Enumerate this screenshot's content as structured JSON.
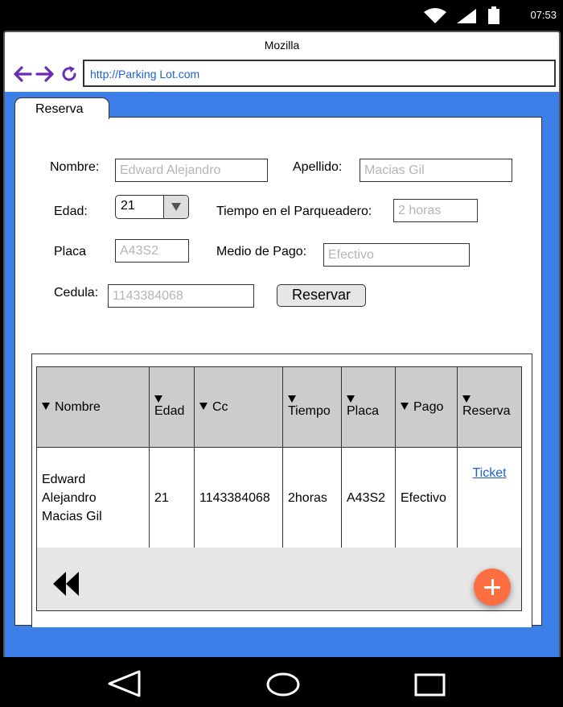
{
  "status_bar": {
    "time": "07:53"
  },
  "browser": {
    "title": "Mozilla",
    "url": "http://Parking Lot.com",
    "icons": {
      "back": "arrow-left-icon",
      "forward": "arrow-right-icon",
      "reload": "reload-icon"
    }
  },
  "tab": {
    "label": "Reserva"
  },
  "form": {
    "nombre": {
      "label": "Nombre:",
      "placeholder": "Edward Alejandro"
    },
    "apellido": {
      "label": "Apellido:",
      "placeholder": "Macias Gil"
    },
    "edad": {
      "label": "Edad:",
      "value": "21"
    },
    "tiempo": {
      "label": "Tiempo en el Parqueadero:",
      "placeholder": "2 horas"
    },
    "placa": {
      "label": "Placa",
      "placeholder": "A43S2"
    },
    "medio_pago": {
      "label": "Medio de Pago:",
      "placeholder": "Efectivo"
    },
    "cedula": {
      "label": "Cedula:",
      "placeholder": "1143384068"
    },
    "reservar_label": "Reservar"
  },
  "table": {
    "headers": [
      "Nombre",
      "Edad",
      "Cc",
      "Tiempo",
      "Placa",
      "Pago",
      "Reserva"
    ],
    "rows": [
      {
        "nombre": [
          "Edward",
          "Alejandro",
          "Macias Gil"
        ],
        "edad": "21",
        "cc": "1143384068",
        "tiempo": "2horas",
        "placa": "A43S2",
        "pago": "Efectivo",
        "reserva": "Ticket"
      }
    ]
  },
  "colors": {
    "content_bg": "#3d7fe8",
    "nav_icon": "#6a2bb5",
    "link": "#1f5fd6",
    "fab": "#ff6e40",
    "header_bg": "#cccccc"
  }
}
